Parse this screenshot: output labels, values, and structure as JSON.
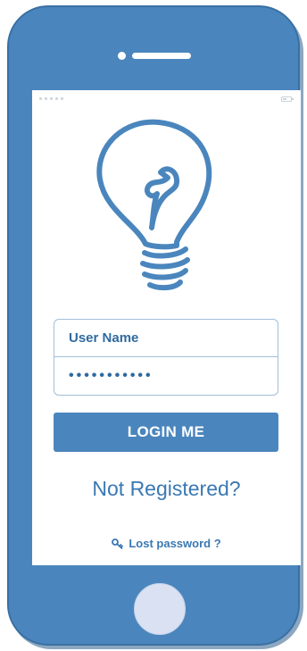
{
  "login": {
    "username_placeholder": "User Name",
    "password_mask": "•••••••••••",
    "button_label": "LOGIN ME",
    "not_registered": "Not Registered?",
    "lost_password": "Lost password ?"
  },
  "icons": {
    "hero": "lightbulb-icon",
    "lost_password": "key-icon"
  },
  "colors": {
    "phone_body": "#4a86bd",
    "accent_text": "#3a78b3",
    "field_border": "#9fbfdb",
    "home_button": "#d9e1f2"
  }
}
